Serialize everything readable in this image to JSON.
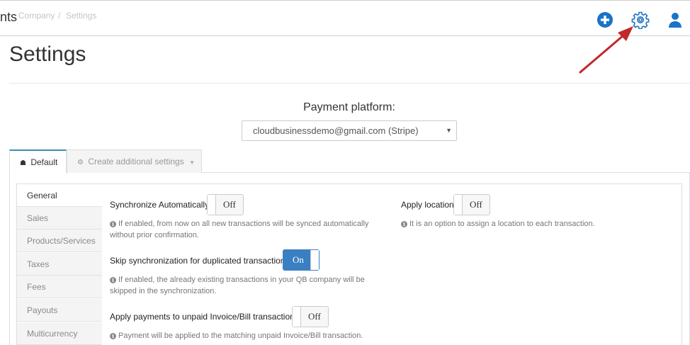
{
  "header": {
    "app_title_fragment": "nts",
    "breadcrumb": {
      "company": "Company",
      "separator": "/",
      "settings": "Settings"
    },
    "icons": {
      "add": "plus-circle-icon",
      "settings": "gear-icon",
      "account": "user-icon"
    },
    "accent_color": "#1a73c8"
  },
  "page": {
    "title": "Settings"
  },
  "payment_platform": {
    "label": "Payment platform:",
    "selected": "cloudbusinessdemo@gmail.com (Stripe)"
  },
  "tabs": [
    {
      "label": "Default",
      "icon": "home-icon",
      "active": true
    },
    {
      "label": "Create additional settings",
      "icon": "gear-icon",
      "active": false
    }
  ],
  "sidebar": {
    "items": [
      {
        "label": "General",
        "active": true
      },
      {
        "label": "Sales",
        "active": false
      },
      {
        "label": "Products/Services",
        "active": false
      },
      {
        "label": "Taxes",
        "active": false
      },
      {
        "label": "Fees",
        "active": false
      },
      {
        "label": "Payouts",
        "active": false
      },
      {
        "label": "Multicurrency",
        "active": false
      }
    ]
  },
  "settings": {
    "sync_auto": {
      "label": "Synchronize Automatically",
      "state": "Off",
      "help_line1": "If enabled, from now on all new transactions will be synced automatically",
      "help_line2": "without prior confirmation."
    },
    "apply_location": {
      "label": "Apply location",
      "state": "Off",
      "help_line1": "It is an option to assign a location to each transaction."
    },
    "skip_duplicates": {
      "label": "Skip synchronization for duplicated transactions",
      "state": "On",
      "help_line1": "If enabled, the already existing transactions in your QB company will be",
      "help_line2": "skipped in the synchronization."
    },
    "apply_payments": {
      "label": "Apply payments to unpaid Invoice/Bill transactions",
      "state": "Off",
      "help_line1": "Payment will be applied to the matching unpaid Invoice/Bill transaction."
    }
  },
  "annotation": {
    "arrow_color": "#c0282a"
  }
}
